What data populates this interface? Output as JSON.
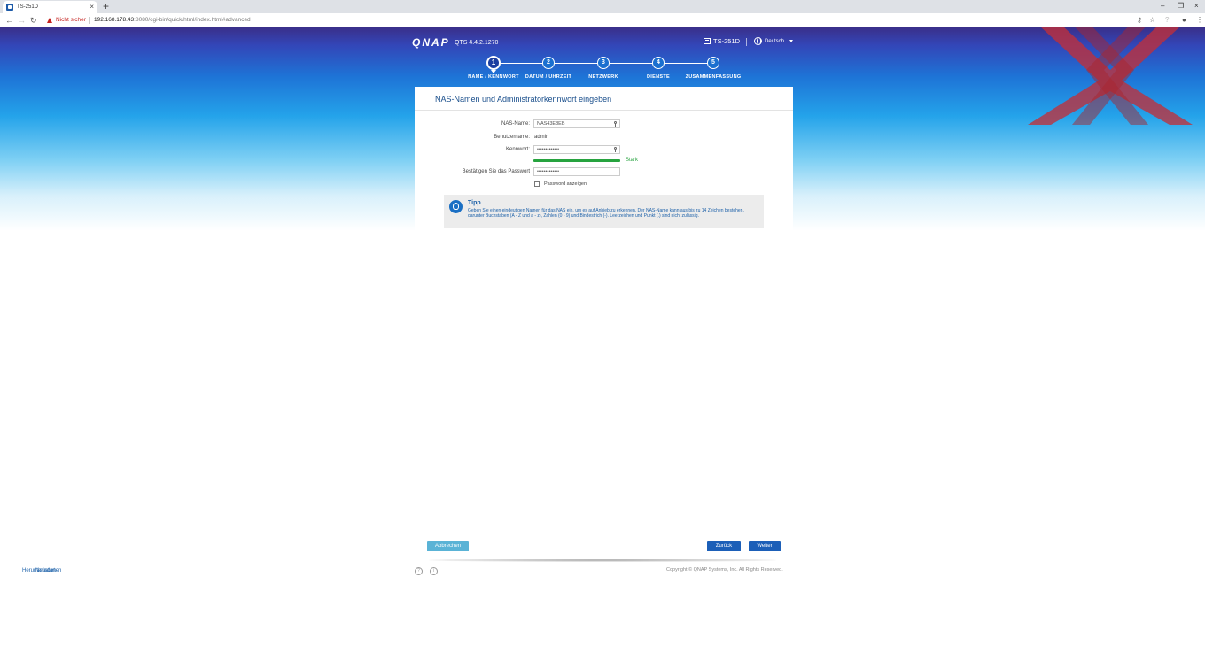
{
  "browser": {
    "tab_title": "TS-251D",
    "tab_close": "×",
    "new_tab": "+",
    "back": "←",
    "forward": "→",
    "reload": "↻",
    "security_label": "Nicht sicher",
    "url_host": "192.168.178.43",
    "url_rest": ":8080/cgi-bin/quick/html/index.html#advanced",
    "window_controls": {
      "minimize": "–",
      "maximize": "❐",
      "close": "×"
    },
    "toolbar_icons": {
      "key": "⚷",
      "star": "☆",
      "extension": "?",
      "profile": "●",
      "menu": "⋮"
    }
  },
  "header": {
    "logo": "QNAP",
    "version": "QTS 4.4.2.1270",
    "device_name": "TS-251D",
    "language": "Deutsch"
  },
  "steps": [
    {
      "number": "1",
      "label": "NAME / KENNWORT",
      "active": true
    },
    {
      "number": "2",
      "label": "DATUM / UHRZEIT",
      "active": false
    },
    {
      "number": "3",
      "label": "NETZWERK",
      "active": false
    },
    {
      "number": "4",
      "label": "DIENSTE",
      "active": false
    },
    {
      "number": "5",
      "label": "ZUSAMMENFASSUNG",
      "active": false
    }
  ],
  "panel": {
    "title": "NAS-Namen und Administratorkennwort eingeben",
    "form": {
      "nas_name_label": "NAS-Name:",
      "nas_name_value": "NAS43E8EB",
      "username_label": "Benutzername:",
      "username_value": "admin",
      "password_label": "Kennwort:",
      "password_value": "•••••••••••••",
      "strength_label": "Stark",
      "confirm_label": "Bestätigen Sie das Passwort",
      "confirm_value": "•••••••••••••",
      "show_password_label": "Password anzeigen",
      "show_password_checked": false
    },
    "tip": {
      "title": "Tipp",
      "text": "Geben Sie einen eindeutigen Namen für das NAS ein, um es auf Anhieb zu erkennen. Der NAS-Name kann aus bis zu 14 Zeichen bestehen, darunter Buchstaben (A - Z und a - z), Zahlen (0 - 9) und Bindestrich (-). Leerzeichen und Punkt (.) sind nicht zulässig."
    },
    "buttons": {
      "cancel": "Abbrechen",
      "back": "Zurück",
      "next": "Weiter"
    }
  },
  "footer": {
    "copyright": "Copyright © QNAP Systems, Inc. All Rights Reserved.",
    "download_link": "Herunterladen",
    "restart_link": "Neustarten"
  }
}
